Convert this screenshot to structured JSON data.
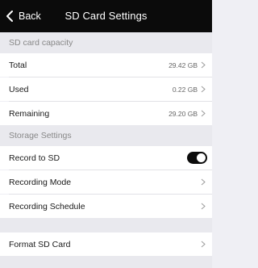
{
  "header": {
    "back_label": "Back",
    "title": "SD Card Settings",
    "back_icon": "chevron-left-icon"
  },
  "capacity_section": {
    "title": "SD card capacity",
    "rows": [
      {
        "label": "Total",
        "value": "29.42 GB"
      },
      {
        "label": "Used",
        "value": "0.22 GB"
      },
      {
        "label": "Remaining",
        "value": "29.20 GB"
      }
    ]
  },
  "storage_section": {
    "title": "Storage Settings",
    "record_to_sd": {
      "label": "Record to SD",
      "enabled": true
    },
    "recording_mode": {
      "label": "Recording Mode"
    },
    "recording_schedule": {
      "label": "Recording Schedule"
    }
  },
  "format_row": {
    "label": "Format SD Card"
  },
  "colors": {
    "header_bg": "#0b0b0b",
    "section_bg": "#e9e9ee",
    "toggle_on": "#0b0b0b"
  }
}
